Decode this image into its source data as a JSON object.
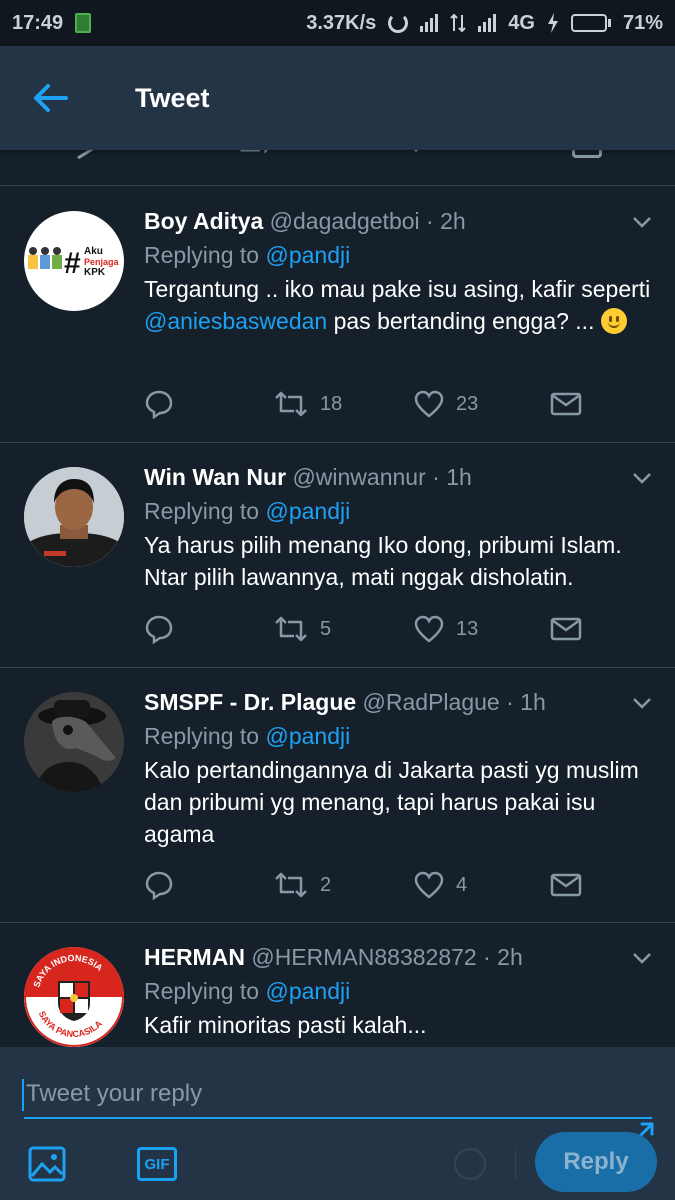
{
  "status_bar": {
    "time": "17:49",
    "speed": "3.37K/s",
    "network": "4G",
    "battery": "71%",
    "battery_level": 0.71
  },
  "appbar": {
    "back_icon": "arrow-left-icon",
    "title": "Tweet"
  },
  "tweets": [
    {
      "name": "Boy Aditya",
      "handle": "@dagadgetboi",
      "dot": "·",
      "age": "2h",
      "replying_prefix": "Replying to",
      "replying_to": "@pandji",
      "text_1": "Tergantung .. iko mau pake isu asing, kafir seperti",
      "mention": "@aniesbaswedan",
      "text_2": "pas bertanding engga? ...",
      "emoji": "slightly-smiling-face",
      "retweets": "18",
      "likes": "23"
    },
    {
      "name": "Win Wan Nur",
      "handle": "@winwannur",
      "dot": "·",
      "age": "1h",
      "replying_prefix": "Replying to",
      "replying_to": "@pandji",
      "text": "Ya harus pilih menang Iko dong, pribumi Islam. Ntar pilih lawannya, mati nggak disholatin.",
      "retweets": "5",
      "likes": "13"
    },
    {
      "name": "SMSPF - Dr. Plague",
      "handle": "@RadPlague",
      "dot": "·",
      "age": "1h",
      "replying_prefix": "Replying to",
      "replying_to": "@pandji",
      "text": "Kalo pertandingannya di Jakarta pasti yg muslim dan pribumi yg menang, tapi harus pakai isu agama",
      "retweets": "2",
      "likes": "4"
    },
    {
      "name": "HERMAN",
      "handle": "@HERMAN88382872",
      "dot": "·",
      "age": "2h",
      "replying_prefix": "Replying to",
      "replying_to": "@pandji",
      "text": "Kafir minoritas pasti kalah..."
    }
  ],
  "avatars": {
    "boy_aditya": {
      "hash": "#",
      "line1": "Aku",
      "line2": "Penjaga",
      "line3": "KPK"
    },
    "herman": {
      "top": "SAYA INDONESIA",
      "bottom": "SAYA PANCASILA"
    }
  },
  "compose": {
    "placeholder": "Tweet your reply",
    "gif_label": "GIF",
    "reply_label": "Reply"
  },
  "colors": {
    "background": "#15202b",
    "header": "#243447",
    "accent": "#1da1f2",
    "muted": "#8899a6",
    "divider": "#38444d"
  }
}
